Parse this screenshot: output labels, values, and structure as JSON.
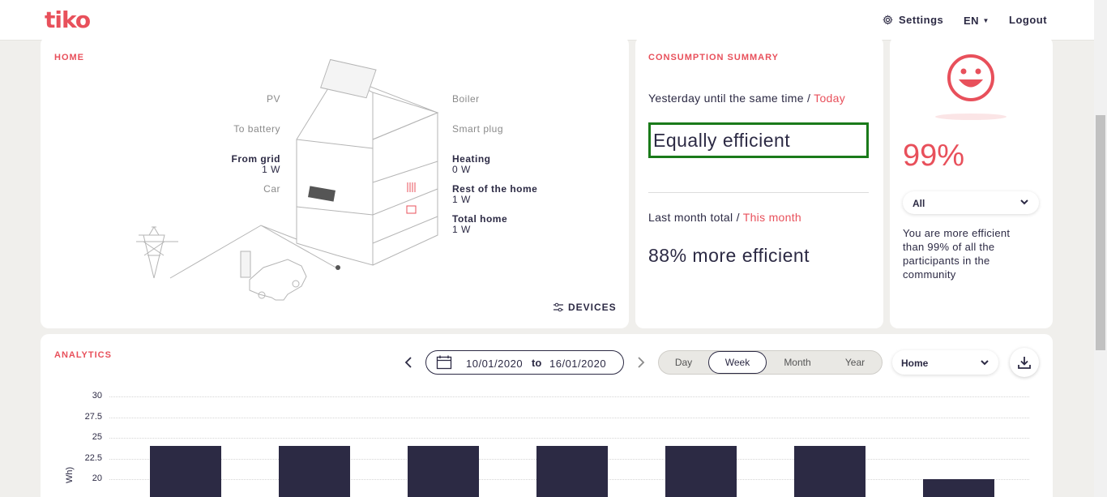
{
  "header": {
    "logo": "tiko",
    "settings_label": "Settings",
    "language_label": "EN",
    "logout_label": "Logout"
  },
  "home": {
    "title": "HOME",
    "labels": {
      "pv": "PV",
      "to_battery": "To battery",
      "from_grid": "From grid",
      "from_grid_value": "1 W",
      "car": "Car",
      "boiler": "Boiler",
      "smart_plug": "Smart plug",
      "heating": "Heating",
      "heating_value": "0 W",
      "rest_of_home": "Rest of the home",
      "rest_of_home_value": "1 W",
      "total_home": "Total home",
      "total_home_value": "1 W"
    },
    "devices_label": "DEVICES"
  },
  "consumption": {
    "title": "CONSUMPTION SUMMARY",
    "compare_prefix": "Yesterday until the same time / ",
    "compare_accent": "Today",
    "daily_result": "Equally efficient",
    "month_prefix": "Last month total / ",
    "month_accent": "This month",
    "monthly_result": "88% more efficient"
  },
  "community": {
    "percent": "99%",
    "filter_value": "All",
    "description": "You are more efficient than 99% of all the participants in the community"
  },
  "analytics": {
    "title": "ANALYTICS",
    "date_from": "10/01/2020",
    "date_to_label": "to",
    "date_to": "16/01/2020",
    "periods": [
      "Day",
      "Week",
      "Month",
      "Year"
    ],
    "active_period": "Week",
    "scope_value": "Home",
    "ylabel_fragment": "Wh)"
  },
  "chart_data": {
    "type": "bar",
    "ylim": [
      17.5,
      30
    ],
    "yticks": [
      "30",
      "27.5",
      "25",
      "22.5",
      "20"
    ],
    "values": [
      24,
      24,
      24,
      24,
      24,
      24,
      20
    ],
    "grid": true
  },
  "colors": {
    "accent": "#e8505b",
    "dark": "#2c2a44",
    "highlight_box": "#1a7a1a"
  }
}
